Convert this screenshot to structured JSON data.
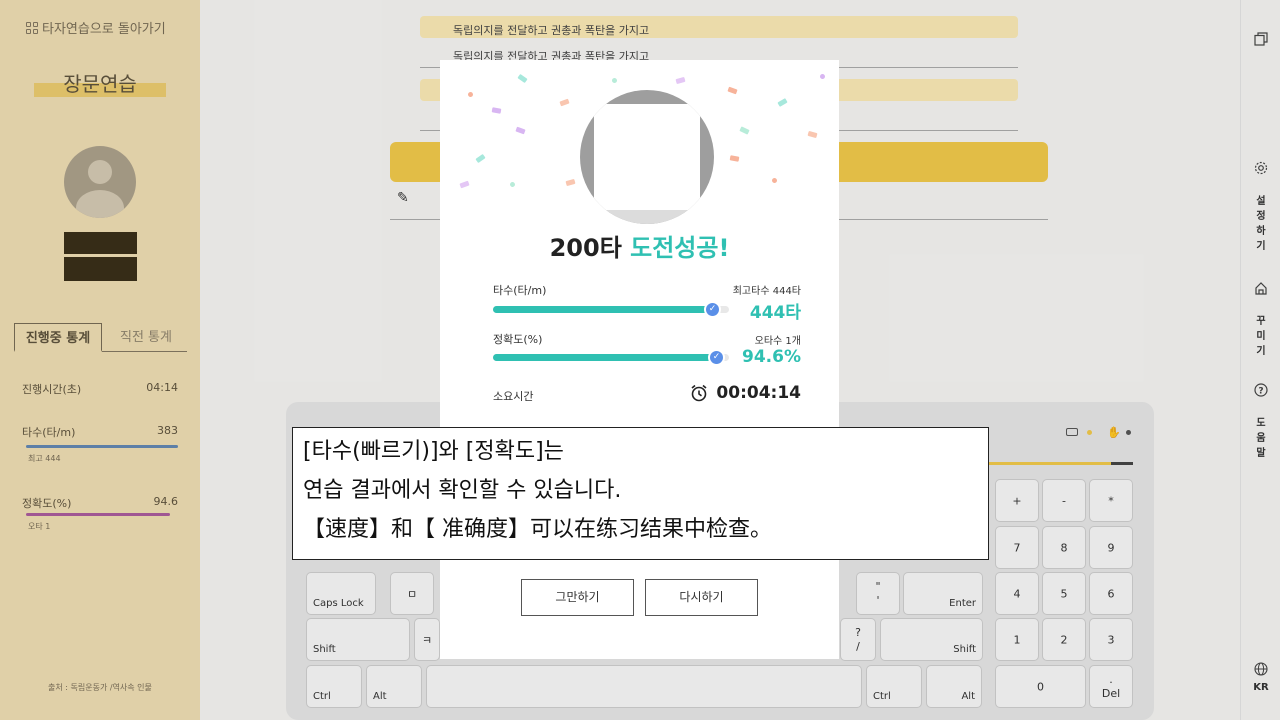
{
  "sidebar": {
    "back_label": "타자연습으로 돌아가기",
    "title": "장문연습",
    "tabs": [
      "진행중 통계",
      "직전 통계"
    ],
    "stats": {
      "elapsed_label": "진행시간(초)",
      "elapsed_value": "04:14",
      "speed_label": "타수(타/m)",
      "speed_value": "383",
      "speed_sub": "최고 444",
      "accuracy_label": "정확도(%)",
      "accuracy_value": "94.6",
      "accuracy_sub": "오타 1"
    },
    "source": "출처 : 독립운동가 /역사속 인물"
  },
  "sentences": [
    "독립의지를 전달하고 권총과 폭탄을 가지고",
    "독립의지를 전달하고 권총과 폭탄을 가지고"
  ],
  "rail": {
    "settings": "설\n정\n하\n기",
    "decorate": "꾸\n미\n기",
    "help": "도\n움\n말",
    "lang": "KR"
  },
  "keyboard": {
    "caps": "Caps Lock",
    "shift_left": "Shift",
    "shift_right": "Shift",
    "ctrl_left": "Ctrl",
    "alt_left": "Alt",
    "ctrl_right": "Ctrl",
    "alt_right": "Alt",
    "enter": "Enter",
    "numpad": [
      "+",
      "-",
      "*",
      "7",
      "8",
      "9",
      "4",
      "5",
      "6",
      "1",
      "2",
      "3",
      "0",
      ".",
      "Del"
    ],
    "square_key": "ㅁ",
    "k_key": "ㅋ",
    "quote_top": "\"",
    "quote_bottom": "'",
    "slash_top": "?",
    "slash_bottom": "/"
  },
  "modal": {
    "title_num": "200타",
    "title_hl": "도전성공!",
    "speed_label": "타수(타/m)",
    "speed_best": "최고타수 444타",
    "speed_value": "444타",
    "speed_progress": 0.93,
    "accuracy_label": "정확도(%)",
    "accuracy_typo": "오타수 1개",
    "accuracy_value": "94.6%",
    "accuracy_progress": 0.946,
    "time_label": "소요시간",
    "time_value": "00:04:14",
    "quit_button": "그만하기",
    "retry_button": "다시하기",
    "accent_color": "#2fc0b2",
    "knob_color": "#5a8fe8"
  },
  "caption": {
    "line1": "[타수(빠르기)]와 [정확도]는",
    "line2": "연습 결과에서 확인할 수 있습니다.",
    "line3": "【速度】和【 准确度】可以在练习结果中检查。"
  }
}
